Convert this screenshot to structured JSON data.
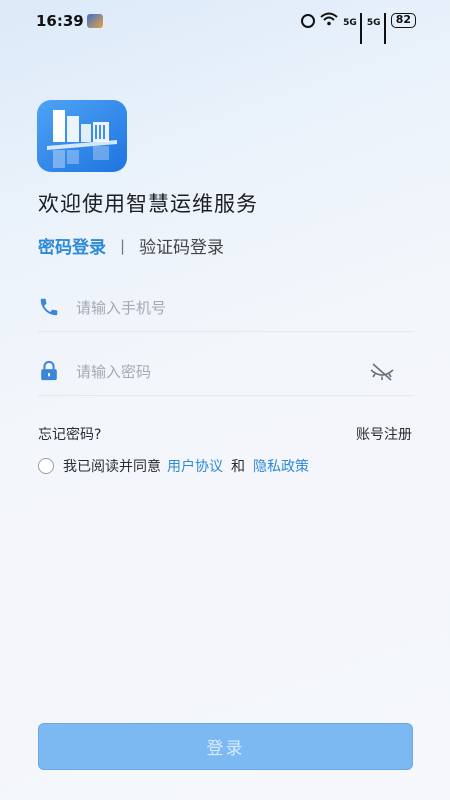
{
  "status_bar": {
    "time": "16:39",
    "signal1_label": "5G",
    "signal2_label": "5G",
    "battery": "82"
  },
  "welcome": {
    "title": "欢迎使用智慧运维服务"
  },
  "tabs": {
    "password_label": "密码登录",
    "separator": "|",
    "code_label": "验证码登录"
  },
  "form": {
    "phone_placeholder": "请输入手机号",
    "phone_value": "",
    "password_placeholder": "请输入密码",
    "password_value": ""
  },
  "links": {
    "forgot": "忘记密码?",
    "register": "账号注册"
  },
  "agreement": {
    "prefix": "我已阅读并同意",
    "user_agreement": "用户协议",
    "and": "和",
    "privacy_policy": "隐私政策"
  },
  "login_button": {
    "label": "登录"
  },
  "colors": {
    "accent": "#2e8ad6",
    "button": "#7cb8f2",
    "icon": "#3b86d9"
  },
  "icons": [
    "phone-icon",
    "lock-icon",
    "eye-off-icon",
    "alarm-icon",
    "wifi-icon"
  ]
}
